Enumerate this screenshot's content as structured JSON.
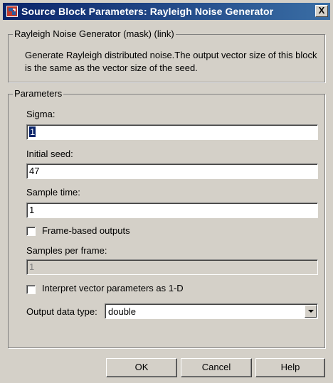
{
  "window": {
    "title": "Source Block Parameters: Rayleigh Noise Generator",
    "close_label": "X"
  },
  "mask": {
    "legend": "Rayleigh Noise Generator (mask) (link)",
    "description": "Generate Rayleigh distributed noise.The output vector size of this block is the same as the vector size of the seed."
  },
  "params": {
    "legend": "Parameters",
    "sigma_label": "Sigma:",
    "sigma_value": "1",
    "seed_label": "Initial seed:",
    "seed_value": "47",
    "sample_time_label": "Sample time:",
    "sample_time_value": "1",
    "frame_based_label": "Frame-based outputs",
    "frame_based_checked": false,
    "samples_per_frame_label": "Samples per frame:",
    "samples_per_frame_value": "1",
    "interpret_label": "Interpret vector parameters as 1-D",
    "interpret_checked": false,
    "output_type_label": "Output data type:",
    "output_type_value": "double"
  },
  "buttons": {
    "ok": "OK",
    "cancel": "Cancel",
    "help": "Help"
  }
}
